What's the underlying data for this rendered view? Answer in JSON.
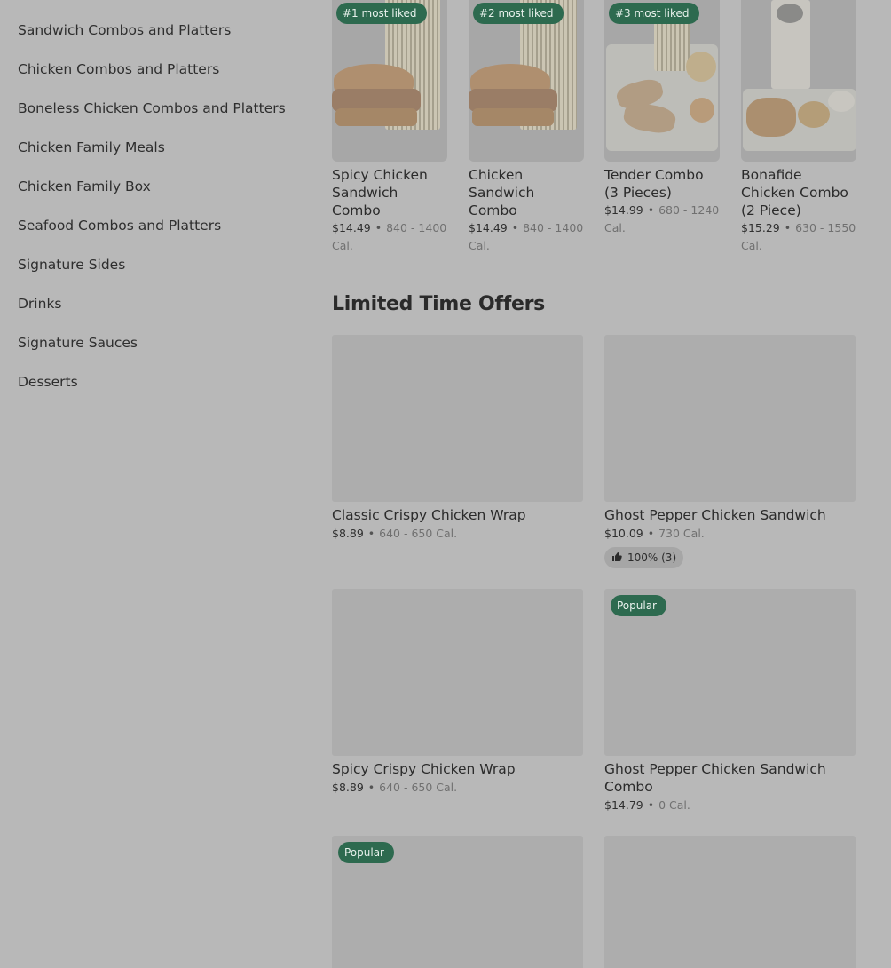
{
  "sidebar": {
    "items": [
      {
        "label": "Sandwich Combos and Platters"
      },
      {
        "label": "Chicken Combos and Platters"
      },
      {
        "label": "Boneless Chicken Combos and Platters"
      },
      {
        "label": "Chicken Family Meals"
      },
      {
        "label": "Chicken Family Box"
      },
      {
        "label": "Seafood Combos and Platters"
      },
      {
        "label": "Signature Sides"
      },
      {
        "label": "Drinks"
      },
      {
        "label": "Signature Sauces"
      },
      {
        "label": "Desserts"
      }
    ]
  },
  "most_liked": [
    {
      "badge": "#1 most liked",
      "name": "Spicy Chicken Sandwich Combo",
      "price": "$14.49",
      "separator": "•",
      "calories": "840 - 1400 Cal."
    },
    {
      "badge": "#2 most liked",
      "name": "Chicken Sandwich Combo",
      "price": "$14.49",
      "separator": "•",
      "calories": "840 - 1400 Cal."
    },
    {
      "badge": "#3 most liked",
      "name": "Tender Combo (3 Pieces)",
      "price": "$14.99",
      "separator": "•",
      "calories": "680 - 1240 Cal."
    },
    {
      "badge": "",
      "name": "Bonafide Chicken Combo (2 Piece)",
      "price": "$15.29",
      "separator": "•",
      "calories": "630 - 1550 Cal."
    }
  ],
  "limited_time": {
    "title": "Limited Time Offers",
    "items": [
      {
        "name": "Classic Crispy Chicken Wrap",
        "price": "$8.89",
        "separator": "•",
        "calories": "640 - 650 Cal.",
        "badge": "",
        "rating": ""
      },
      {
        "name": "Ghost Pepper Chicken Sandwich",
        "price": "$10.09",
        "separator": "•",
        "calories": "730 Cal.",
        "badge": "",
        "rating": "100% (3)"
      },
      {
        "name": "Spicy Crispy Chicken Wrap",
        "price": "$8.89",
        "separator": "•",
        "calories": "640 - 650 Cal.",
        "badge": "",
        "rating": ""
      },
      {
        "name": "Ghost Pepper Chicken Sandwich Combo",
        "price": "$14.79",
        "separator": "•",
        "calories": "0 Cal.",
        "badge": "Popular",
        "rating": ""
      },
      {
        "name": "",
        "price": "",
        "separator": "",
        "calories": "",
        "badge": "Popular",
        "rating": ""
      },
      {
        "name": "",
        "price": "",
        "separator": "",
        "calories": "",
        "badge": "",
        "rating": ""
      }
    ]
  },
  "colors": {
    "overlay_background": "#b8b8b8",
    "badge_green": "#2d6a4f",
    "placeholder": "#adadad"
  },
  "icons": {
    "rating": "thumbs-up-icon"
  }
}
